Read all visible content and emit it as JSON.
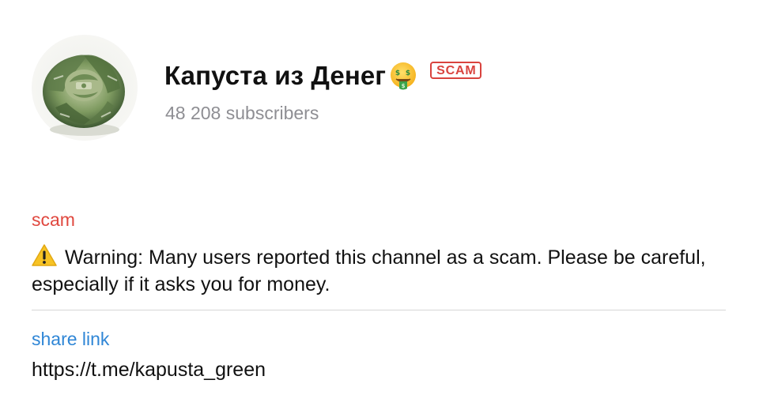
{
  "channel": {
    "name": "Капуста из Денег",
    "badge": "SCAM",
    "subscribers": "48 208 subscribers",
    "emoji_icon": "money-mouth-face-icon",
    "avatar_icon": "money-cabbage-avatar"
  },
  "scam_section": {
    "label": "scam",
    "warning_icon": "warning-icon",
    "text": "Warning: Many users reported this channel as a scam. Please be careful, especially if it asks you for money."
  },
  "share_section": {
    "label": "share link",
    "url": "https://t.me/kapusta_green"
  },
  "colors": {
    "scam_red": "#e0483f",
    "link_blue": "#2f86d6",
    "muted_gray": "#8e8e93",
    "divider": "#d6d6d6"
  }
}
